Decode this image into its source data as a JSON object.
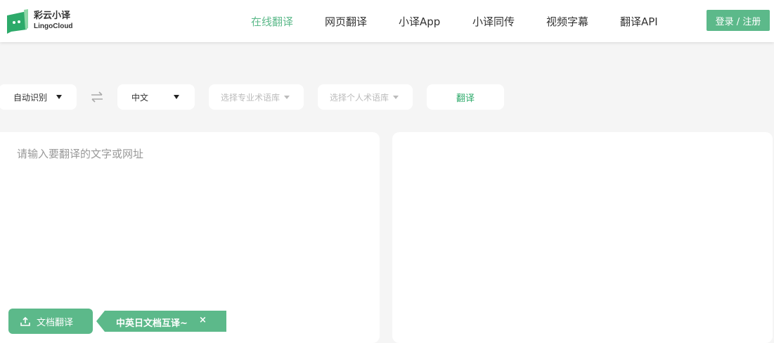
{
  "brand": {
    "name_cn": "彩云小译",
    "name_en": "LingoCloud",
    "color": "#5cb98a"
  },
  "nav": {
    "items": [
      {
        "label": "在线翻译",
        "active": true
      },
      {
        "label": "网页翻译"
      },
      {
        "label": "小译App"
      },
      {
        "label": "小译同传"
      },
      {
        "label": "视频字幕"
      },
      {
        "label": "翻译API"
      }
    ],
    "login": "登录 / 注册"
  },
  "toolbar": {
    "source_lang": "自动识别",
    "target_lang": "中文",
    "pro_glossary": "选择专业术语库",
    "personal_glossary": "选择个人术语库",
    "translate": "翻译"
  },
  "input": {
    "placeholder": "请输入要翻译的文字或网址",
    "value": ""
  },
  "doc": {
    "button": "文档翻译",
    "tip": "中英日文档互译~",
    "tip_close": "×"
  }
}
